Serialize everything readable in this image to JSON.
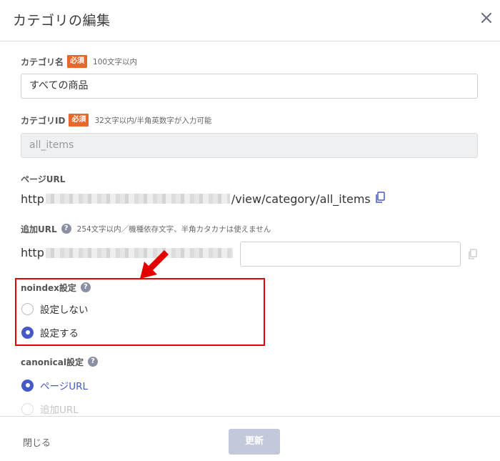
{
  "dialog": {
    "title": "カテゴリの編集"
  },
  "category_name": {
    "label": "カテゴリ名",
    "required": "必須",
    "hint": "100文字以内",
    "value": "すべての商品"
  },
  "category_id": {
    "label": "カテゴリID",
    "required": "必須",
    "hint": "32文字以内/半角英数字が入力可能",
    "value": "all_items"
  },
  "page_url": {
    "label": "ページURL",
    "prefix": "http",
    "suffix": "/view/category/all_items"
  },
  "extra_url": {
    "label": "追加URL",
    "help": "?",
    "hint": "254文字以内／機種依存文字、半角カタカナは使えません",
    "prefix": "http",
    "value": ""
  },
  "noindex": {
    "label": "noindex設定",
    "help": "?",
    "options": [
      {
        "label": "設定しない",
        "selected": false
      },
      {
        "label": "設定する",
        "selected": true
      }
    ]
  },
  "canonical": {
    "label": "canonical設定",
    "help": "?",
    "options": [
      {
        "label": "ページURL",
        "selected": true
      },
      {
        "label": "追加URL",
        "selected": false
      }
    ]
  },
  "footer": {
    "close_label": "閉じる",
    "save_label": "更新"
  },
  "colors": {
    "accent": "#4659c9",
    "required_badge": "#e6692b",
    "highlight": "#e40000",
    "save_disabled": "#c3c9da"
  },
  "icons": {
    "close": "close-icon",
    "copy": "copy-icon",
    "help": "help-icon",
    "annotation_arrow": "arrow-icon"
  }
}
